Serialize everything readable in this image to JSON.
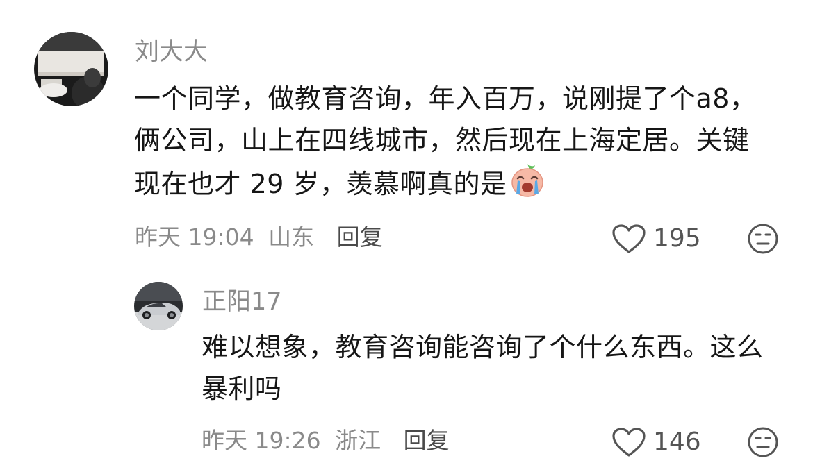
{
  "comments": [
    {
      "username": "刘大大",
      "text": "一个同学，做教育咨询，年入百万，说刚提了个a8，俩公司，山上在四线城市，然后现在上海定居。关键现在也才 29 岁，羡慕啊真的是",
      "emoji": "crying-peach-emoji",
      "time": "昨天 19:04",
      "location": "山东",
      "reply_label": "回复",
      "likes": "195"
    },
    {
      "username": "正阳17",
      "text": "难以想象，教育咨询能咨询了个什么东西。这么暴利吗",
      "time": "昨天 19:26",
      "location": "浙江",
      "reply_label": "回复",
      "likes": "146"
    }
  ],
  "icons": {
    "like": "heart-outline-icon",
    "dislike": "meh-face-icon"
  },
  "colors": {
    "username": "#8a8a8a",
    "text": "#161616",
    "meta": "#8a8a8a",
    "icon": "#555555"
  }
}
